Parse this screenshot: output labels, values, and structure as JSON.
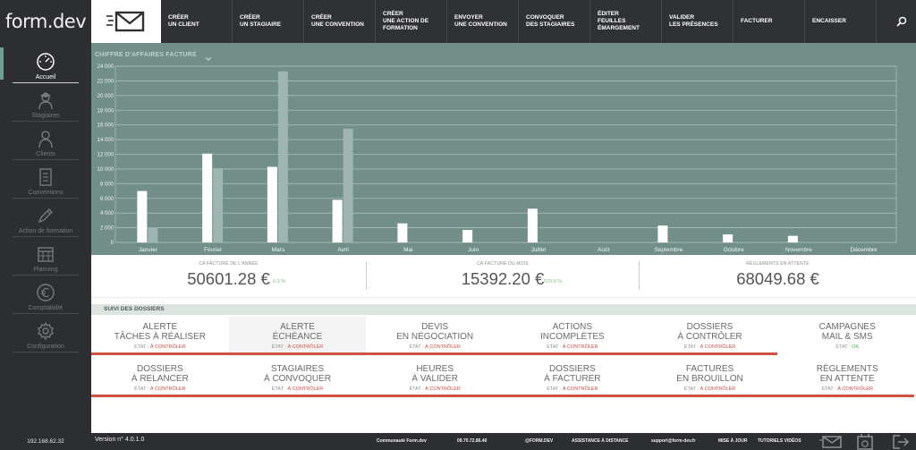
{
  "app": {
    "logo": "form.dev",
    "ip": "192.168.62.32"
  },
  "sidebar": {
    "items": [
      {
        "label": "Accueil",
        "icon": "dashboard-icon",
        "active": true
      },
      {
        "label": "Stagiaires",
        "icon": "trainee-icon"
      },
      {
        "label": "Clients",
        "icon": "client-icon"
      },
      {
        "label": "Conventions",
        "icon": "contract-icon"
      },
      {
        "label": "Action de formation",
        "icon": "pencil-icon"
      },
      {
        "label": "Planning",
        "icon": "calendar-icon"
      },
      {
        "label": "Comptabilité",
        "icon": "euro-icon"
      },
      {
        "label": "Configuration",
        "icon": "gear-icon"
      }
    ]
  },
  "topbar": {
    "actions": [
      "CRÉER\nUN CLIENT",
      "CRÉER\nUN STAGIAIRE",
      "CRÉER\nUNE CONVENTION",
      "CRÉER\nUNE ACTION DE\nFORMATION",
      "ENVOYER\nUNE CONVENTION",
      "CONVOQUER\nDES STAGIAIRES",
      "ÉDITER\nFEUILLES\nÉMARGEMENT",
      "VALIDER\nLES PRÉSENCES",
      "FACTURER",
      "ENCAISSER"
    ]
  },
  "chart_data": {
    "type": "bar",
    "title": "CHIFFRE D'AFFAIRES FACTURÉ",
    "categories": [
      "Janvier",
      "Février",
      "Mars",
      "Avril",
      "Mai",
      "Juin",
      "Juillet",
      "Août",
      "Septembre",
      "Octobre",
      "Novembre",
      "Décembre"
    ],
    "series": [
      {
        "values": [
          7000,
          12100,
          10300,
          5800,
          2600,
          1700,
          4600,
          0,
          2300,
          1100,
          900,
          0
        ]
      },
      {
        "values": [
          2000,
          10100,
          23300,
          15500,
          0,
          0,
          0,
          0,
          0,
          0,
          0,
          0
        ]
      }
    ],
    "yticks": [
      "0",
      "2 000",
      "4 000",
      "6 000",
      "8 000",
      "10 000",
      "12 000",
      "14 000",
      "16 000",
      "18 000",
      "20 000",
      "22 000",
      "24 000"
    ],
    "ylim": [
      0,
      24000
    ],
    "grid": true,
    "colors": {
      "series1": "#ffffff",
      "series2": "#9fb5b1",
      "background": "#718e89"
    }
  },
  "stats": [
    {
      "label": "CA FACTURÉ DE L'ANNÉE",
      "value": "50601.28 €",
      "pct": "6.3 %"
    },
    {
      "label": "CA FACTURÉ DU MOIS",
      "value": "15392.20 €",
      "pct": "570.0 %"
    },
    {
      "label": "RÈGLEMENTS EN ATTENTE",
      "value": "68049.68 €",
      "pct": ""
    }
  ],
  "suivi": {
    "title": "SUIVI DES DOSSIERS",
    "state_prefix": "ÉTAT :",
    "row1": [
      {
        "title": "ALERTE\nTÂCHES À  RÉALISER",
        "state": "À CONTRÔLER",
        "status": "bad"
      },
      {
        "title": "ALERTE\nÉCHÉANCE",
        "state": "À CONTRÔLER",
        "status": "bad"
      },
      {
        "title": "DEVIS\nEN NÉGOCIATION",
        "state": "À CONTRÔLER",
        "status": "bad"
      },
      {
        "title": "ACTIONS\nINCOMPLÈTES",
        "state": "À CONTRÔLER",
        "status": "bad"
      },
      {
        "title": "DOSSIERS\nÀ CONTRÔLER",
        "state": "À CONTRÔLER",
        "status": "bad"
      },
      {
        "title": "CAMPAGNES\nMAIL & SMS",
        "state": "OK",
        "status": "ok"
      }
    ],
    "row2": [
      {
        "title": "DOSSIERS\nÀ RELANCER",
        "state": "À CONTRÔLER",
        "status": "bad"
      },
      {
        "title": "STAGIAIRES\nÀ CONVOQUER",
        "state": "À CONTRÔLER",
        "status": "bad"
      },
      {
        "title": "HEURES\nÀ VALIDER",
        "state": "À CONTRÔLER",
        "status": "bad"
      },
      {
        "title": "DOSSIERS\nÀ FACTURER",
        "state": "À CONTRÔLER",
        "status": "bad"
      },
      {
        "title": "FACTURES\nEN BROUILLON",
        "state": "À CONTRÔLER",
        "status": "bad"
      },
      {
        "title": "RÈGLEMENTS\nEN ATTENTE",
        "state": "À CONTRÔLER",
        "status": "bad"
      }
    ]
  },
  "footer": {
    "version": "Version n° 4.0.1.0",
    "community": "Communauté Form.dev",
    "phone": "09.70.72.86.46",
    "brand": "@FORM.DEV",
    "assistance": "ASSISTANCE À DISTANCE",
    "email": "support@form-dev.fr",
    "update": "MISE À JOUR",
    "tutorials": "TUTORIELS VIDÉOS"
  }
}
